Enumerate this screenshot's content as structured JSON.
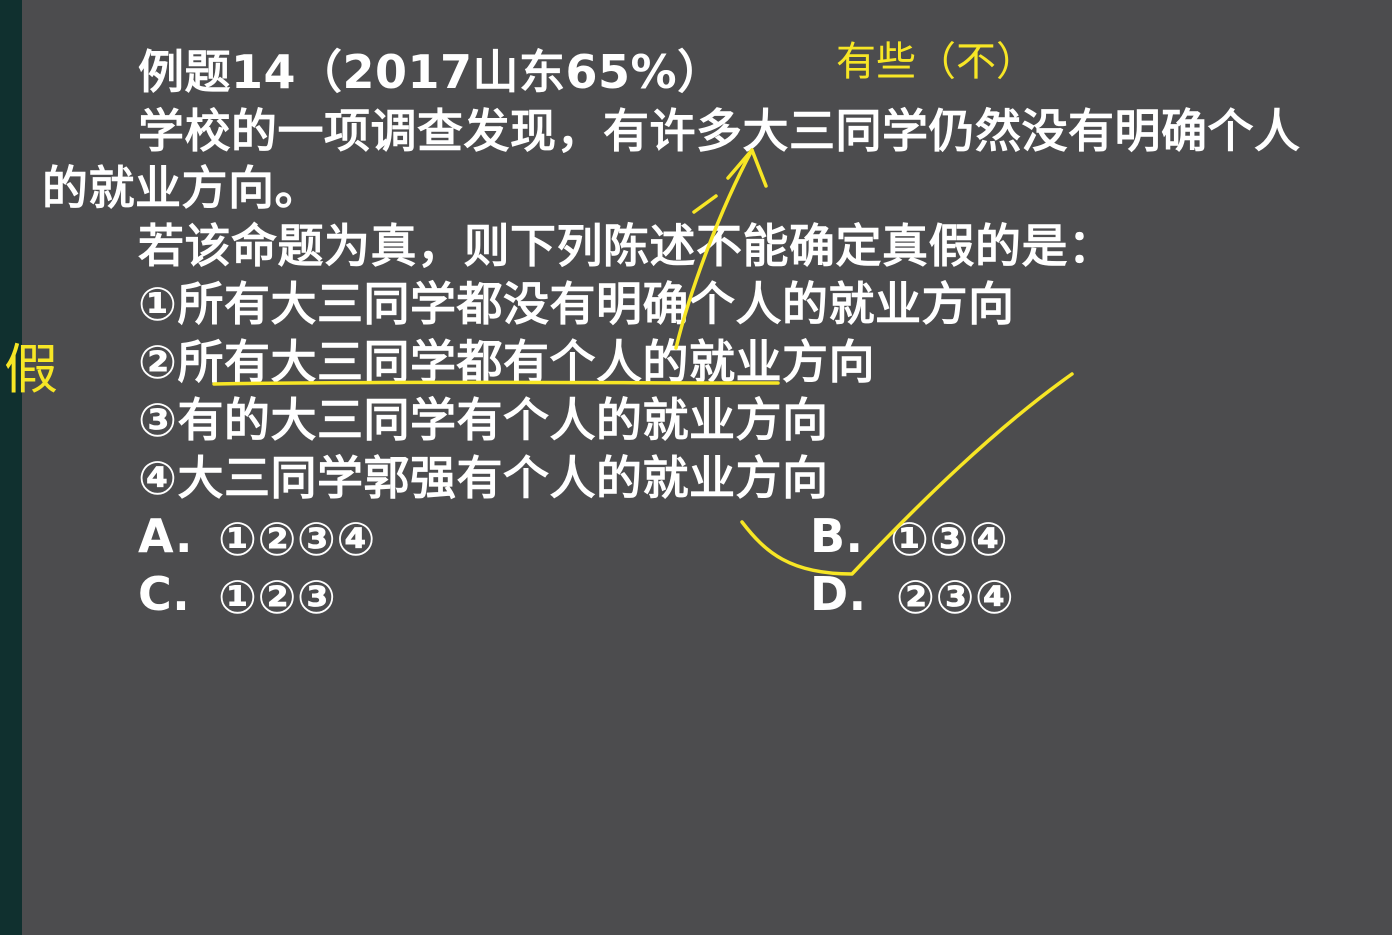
{
  "question": {
    "title": "例题14（2017山东65%）",
    "stem_line1": "学校的一项调查发现，有许多大三同学仍然没有明确个人",
    "stem_line2": "的就业方向。",
    "prompt": "若该命题为真，则下列陈述不能确定真假的是：",
    "statements": [
      "①所有大三同学都没有明确个人的就业方向",
      "②所有大三同学都有个人的就业方向",
      "③有的大三同学有个人的就业方向",
      "④大三同学郭强有个人的就业方向"
    ],
    "options": {
      "a_letter": "A.",
      "a_value": "①②③④",
      "b_letter": "B.",
      "b_value": "①③④",
      "c_letter": "C.",
      "c_value": "①②③",
      "d_letter": "D.",
      "d_value": "②③④"
    }
  },
  "annotations": {
    "top_note": "有些（不）",
    "left_note": "假",
    "ink_color": "#f7e625"
  }
}
